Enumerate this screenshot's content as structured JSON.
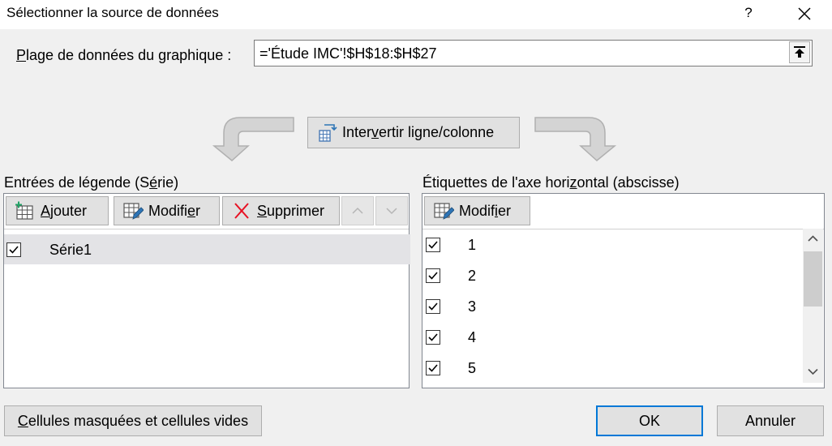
{
  "dialog": {
    "title": "Sélectionner la source de données",
    "help_label": "?"
  },
  "range": {
    "label_pre": "",
    "label_key": "P",
    "label_post": "lage de données du graphique :",
    "value": "='Étude IMC'!$H$18:$H$27"
  },
  "switch_button": {
    "pre": "Inter",
    "key": "v",
    "post": "ertir ligne/colonne"
  },
  "legend_section": {
    "label_pre": "Entrées de légende (S",
    "label_key": "é",
    "label_post": "rie)",
    "buttons": {
      "add": {
        "key": "A",
        "rest": "jouter"
      },
      "edit": {
        "pre": "Modifi",
        "key": "e",
        "post": "r"
      },
      "delete": {
        "key": "S",
        "rest": "upprimer"
      }
    },
    "series": [
      {
        "name": "Série1",
        "checked": true
      }
    ]
  },
  "axis_section": {
    "label_pre": "Étiquettes de l'axe hori",
    "label_key": "z",
    "label_post": "ontal (abscisse)",
    "edit_pre": "Modif",
    "edit_key": "i",
    "edit_post": "er",
    "items": [
      "1",
      "2",
      "3",
      "4",
      "5"
    ]
  },
  "footer": {
    "hidden_cells_key": "C",
    "hidden_cells_rest": "ellules masquées et cellules vides",
    "ok": "OK",
    "cancel": "Annuler"
  },
  "colors": {
    "accent": "#0078d7",
    "delete_red": "#e81123",
    "add_green": "#21a366"
  }
}
